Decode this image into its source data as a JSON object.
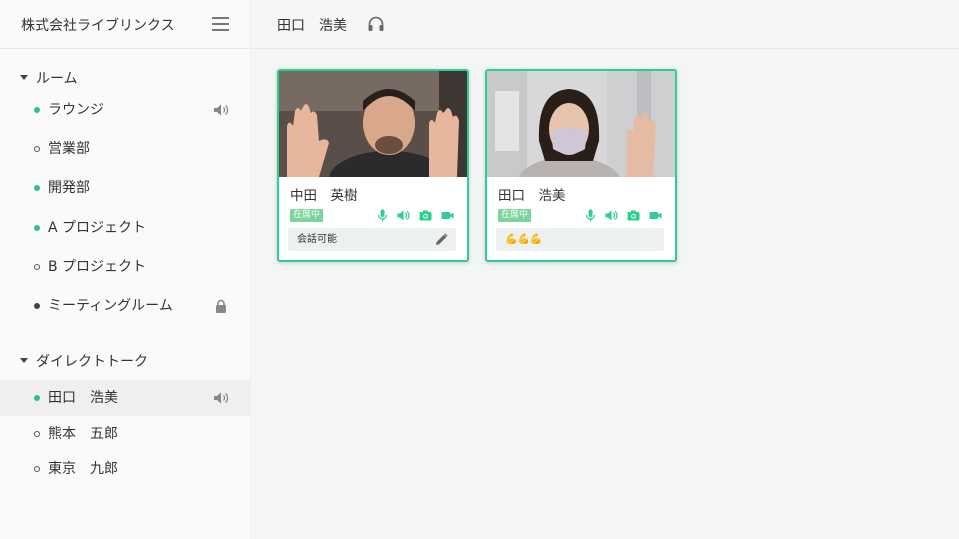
{
  "sidebar": {
    "company": "株式会社ライブリンクス",
    "menu_icon": "hamburger-menu-icon",
    "rooms_header": "ルーム",
    "rooms": [
      {
        "label": "ラウンジ",
        "status": "online",
        "trail_icon": "speaker-icon"
      },
      {
        "label": "営業部",
        "status": "offline"
      },
      {
        "label": "開発部",
        "status": "online"
      },
      {
        "label": "A プロジェクト",
        "status": "online"
      },
      {
        "label": "B プロジェクト",
        "status": "offline"
      },
      {
        "label": "ミーティングルーム",
        "status": "busy",
        "trail_icon": "lock-icon"
      }
    ],
    "direct_header": "ダイレクトトーク",
    "direct": [
      {
        "label": "田口　浩美",
        "status": "online",
        "trail_icon": "speaker-icon",
        "active": true
      },
      {
        "label": "熊本　五郎",
        "status": "offline"
      },
      {
        "label": "東京　九郎",
        "status": "offline"
      }
    ]
  },
  "topbar": {
    "name": "田口　浩美",
    "icon": "headset-icon"
  },
  "cards": [
    {
      "name": "中田　英樹",
      "badge": "在席中",
      "status_text": "会話可能",
      "icons": [
        "microphone-icon",
        "speaker-icon",
        "camera-icon",
        "video-icon"
      ],
      "edit_icon": "pencil-icon"
    },
    {
      "name": "田口　浩美",
      "badge": "在席中",
      "status_text": "💪💪💪",
      "icons": [
        "microphone-icon",
        "speaker-icon",
        "camera-icon",
        "video-icon"
      ]
    }
  ],
  "colors": {
    "accent": "#2ccf92",
    "online": "#23c48e",
    "badge": "#7ed49b",
    "active_row": "#efefef"
  }
}
